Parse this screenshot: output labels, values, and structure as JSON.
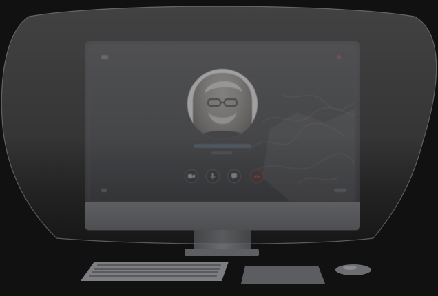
{
  "scene": {
    "colors": {
      "background": "#111111",
      "lens_tint": "#5a5a5c",
      "end_call": "#b94444"
    }
  },
  "call_screen": {
    "caller_photo": "man-portrait",
    "caller_name": "",
    "caller_status": "",
    "buttons": [
      {
        "icon": "video-icon",
        "name": "video"
      },
      {
        "icon": "microphone-icon",
        "name": "mute"
      },
      {
        "icon": "message-icon",
        "name": "chat"
      },
      {
        "icon": "phone-hangup-icon",
        "name": "end-call"
      }
    ]
  },
  "devices": {
    "monitor": "desktop-monitor",
    "keyboard": "keyboard",
    "trackpad": "trackpad",
    "mouse": "mouse"
  }
}
